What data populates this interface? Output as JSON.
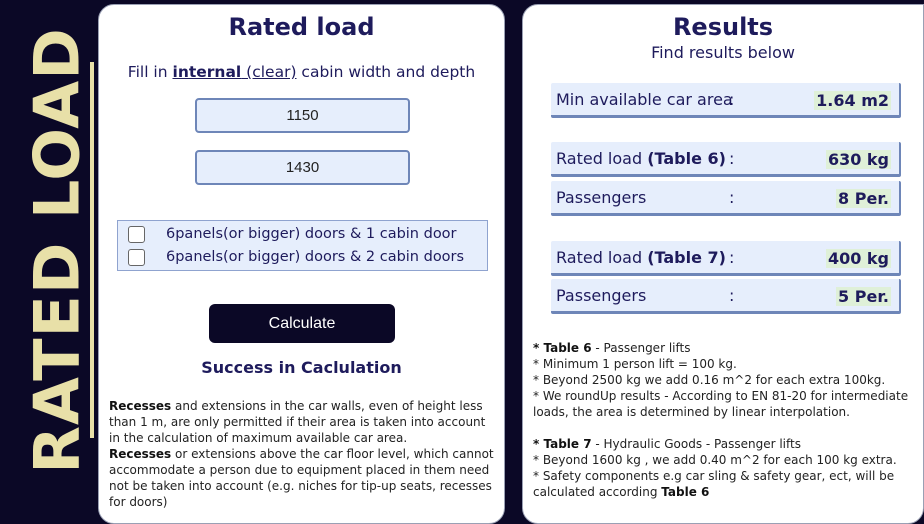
{
  "banner": {
    "title": "RATED LOAD"
  },
  "left": {
    "title": "Rated load",
    "instruction": {
      "pre": "Fill in ",
      "strong": "internal",
      "paren": " (clear)",
      "post": " cabin width and depth"
    },
    "width_value": "1150",
    "depth_value": "1430",
    "options": [
      {
        "label": "6panels(or bigger) doors & 1 cabin door",
        "checked": false
      },
      {
        "label": "6panels(or bigger) doors & 2 cabin doors",
        "checked": false
      }
    ],
    "calculate_label": "Calculate",
    "success_text": "Success in Caclulation",
    "notes": {
      "p1_bold": "Recesses",
      "p1_text": " and extensions in the car walls, even of height less than 1 m, are only permitted if their area is taken into account in the calculation of maximum available car area.",
      "p2_bold": "Recesses",
      "p2_text": " or extensions above the car floor level, which cannot accommodate a person due to equipment placed in them need not be taken into account (e.g. niches for tip-up seats, recesses for doors)"
    }
  },
  "right": {
    "title": "Results",
    "subtitle": "Find results below",
    "rows": [
      {
        "label": "Min available car area",
        "label_bold": "",
        "colon": ":",
        "value": "1.64  m2"
      },
      {
        "label": "Rated load ",
        "label_bold": "(Table 6)",
        "colon": ":",
        "value": "630  kg"
      },
      {
        "label": "Passengers",
        "label_bold": "",
        "colon": ":",
        "value": "8  Per."
      },
      {
        "label": "Rated load ",
        "label_bold": "(Table 7)",
        "colon": ":",
        "value": "400  kg"
      },
      {
        "label": "Passengers",
        "label_bold": "",
        "colon": ":",
        "value": "5  Per."
      }
    ],
    "notes": {
      "t6_bold": "* Table 6",
      "t6_text": " - Passenger lifts",
      "t6_l1": "* Minimum 1 person lift = 100 kg.",
      "t6_l2": "* Beyond 2500 kg we add 0.16 m^2 for each extra 100kg.",
      "t6_l3": "* We roundUp results - According to EN 81-20 for intermediate loads, the area is determined by linear interpolation.",
      "t7_bold": "* Table 7",
      "t7_text": " - Hydraulic Goods - Passenger lifts",
      "t7_l1": "* Beyond 1600 kg , we add 0.40 m^2 for each 100 kg extra.",
      "t7_l2_pre": "* Safety components e.g car sling & safety gear, ect, will be calculated according ",
      "t7_l2_bold": "Table 6"
    }
  }
}
